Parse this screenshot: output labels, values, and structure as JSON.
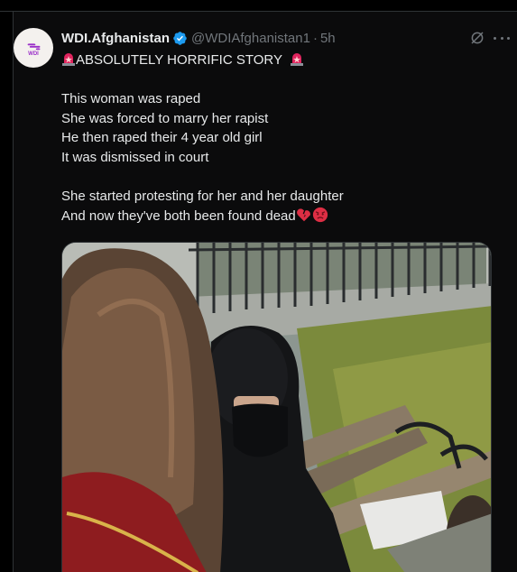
{
  "user": {
    "display_name": "WDI.Afghanistan",
    "handle": "@WDIAfghanistan1",
    "separator": "·",
    "time": "5h",
    "avatar_mark": "ᯓ",
    "avatar_text": "WDI"
  },
  "tweet": {
    "headline": "ABSOLUTELY HORRIFIC STORY",
    "lines": [
      "This woman was raped",
      "She was forced to marry her rapist",
      "He then raped their 4 year old girl",
      "It was dismissed in court",
      "",
      "She started protesting for her and her daughter",
      "And now they've both been found dead"
    ]
  },
  "icons": {
    "verified": "verified-badge-icon",
    "siren": "police-siren-icon",
    "broken_heart": "broken-heart-icon",
    "angry_face": "angry-face-icon",
    "grok": "grok-icon",
    "more": "more-options-icon"
  },
  "colors": {
    "background": "#000000",
    "text_primary": "#e7e9ea",
    "text_secondary": "#71767b",
    "verified": "#1d9bf0",
    "brand_purple": "#9b30c9"
  }
}
